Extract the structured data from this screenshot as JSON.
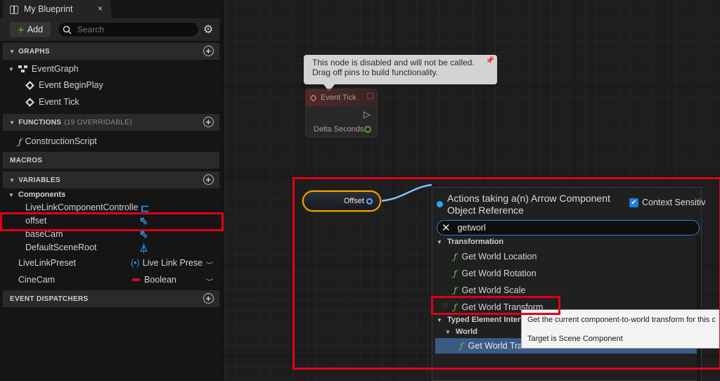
{
  "tab": {
    "title": "My Blueprint",
    "close": "×"
  },
  "toolbar": {
    "add_label": "Add",
    "search_placeholder": "Search"
  },
  "sections": {
    "graphs": "GRAPHS",
    "functions": "FUNCTIONS",
    "functions_sub": "(19 OVERRIDABLE)",
    "macros": "MACROS",
    "variables": "VARIABLES",
    "dispatchers": "EVENT DISPATCHERS"
  },
  "graphs": {
    "event_graph": "EventGraph",
    "events": [
      "Event BeginPlay",
      "Event Tick"
    ]
  },
  "functions": {
    "items": [
      "ConstructionScript"
    ]
  },
  "variables": {
    "components_label": "Components",
    "components": [
      "LiveLinkComponentControlle",
      "offset",
      "baseCam",
      "DefaultSceneRoot"
    ],
    "others": [
      {
        "name": "LiveLinkPreset",
        "type": "Live Link Prese"
      },
      {
        "name": "CineCam",
        "type": "Boolean"
      }
    ]
  },
  "graph": {
    "comment": [
      "This node is disabled and will not be called.",
      "Drag off pins to build functionality."
    ],
    "event_tick": {
      "title": "Event Tick",
      "pin": "Delta Seconds"
    },
    "offset_node": "Offset"
  },
  "menu": {
    "title": "Actions taking a(n) Arrow Component Object Reference",
    "context_label": "Context Sensitiv",
    "search_value": "getworl",
    "category": "Transformation",
    "items": [
      "Get World Location",
      "Get World Rotation",
      "Get World Scale",
      "Get World Transform"
    ],
    "category2": "Typed Element Interfa",
    "subcategory": "World",
    "selected_item": "Get World Tra"
  },
  "tooltip": {
    "line1": "Get the current component-to-world transform for this c",
    "line2": "Target is Scene Component"
  },
  "colors": {
    "highlight": "#e0001a",
    "accent": "#23a8ff",
    "function_icon": "#5fd24a"
  }
}
